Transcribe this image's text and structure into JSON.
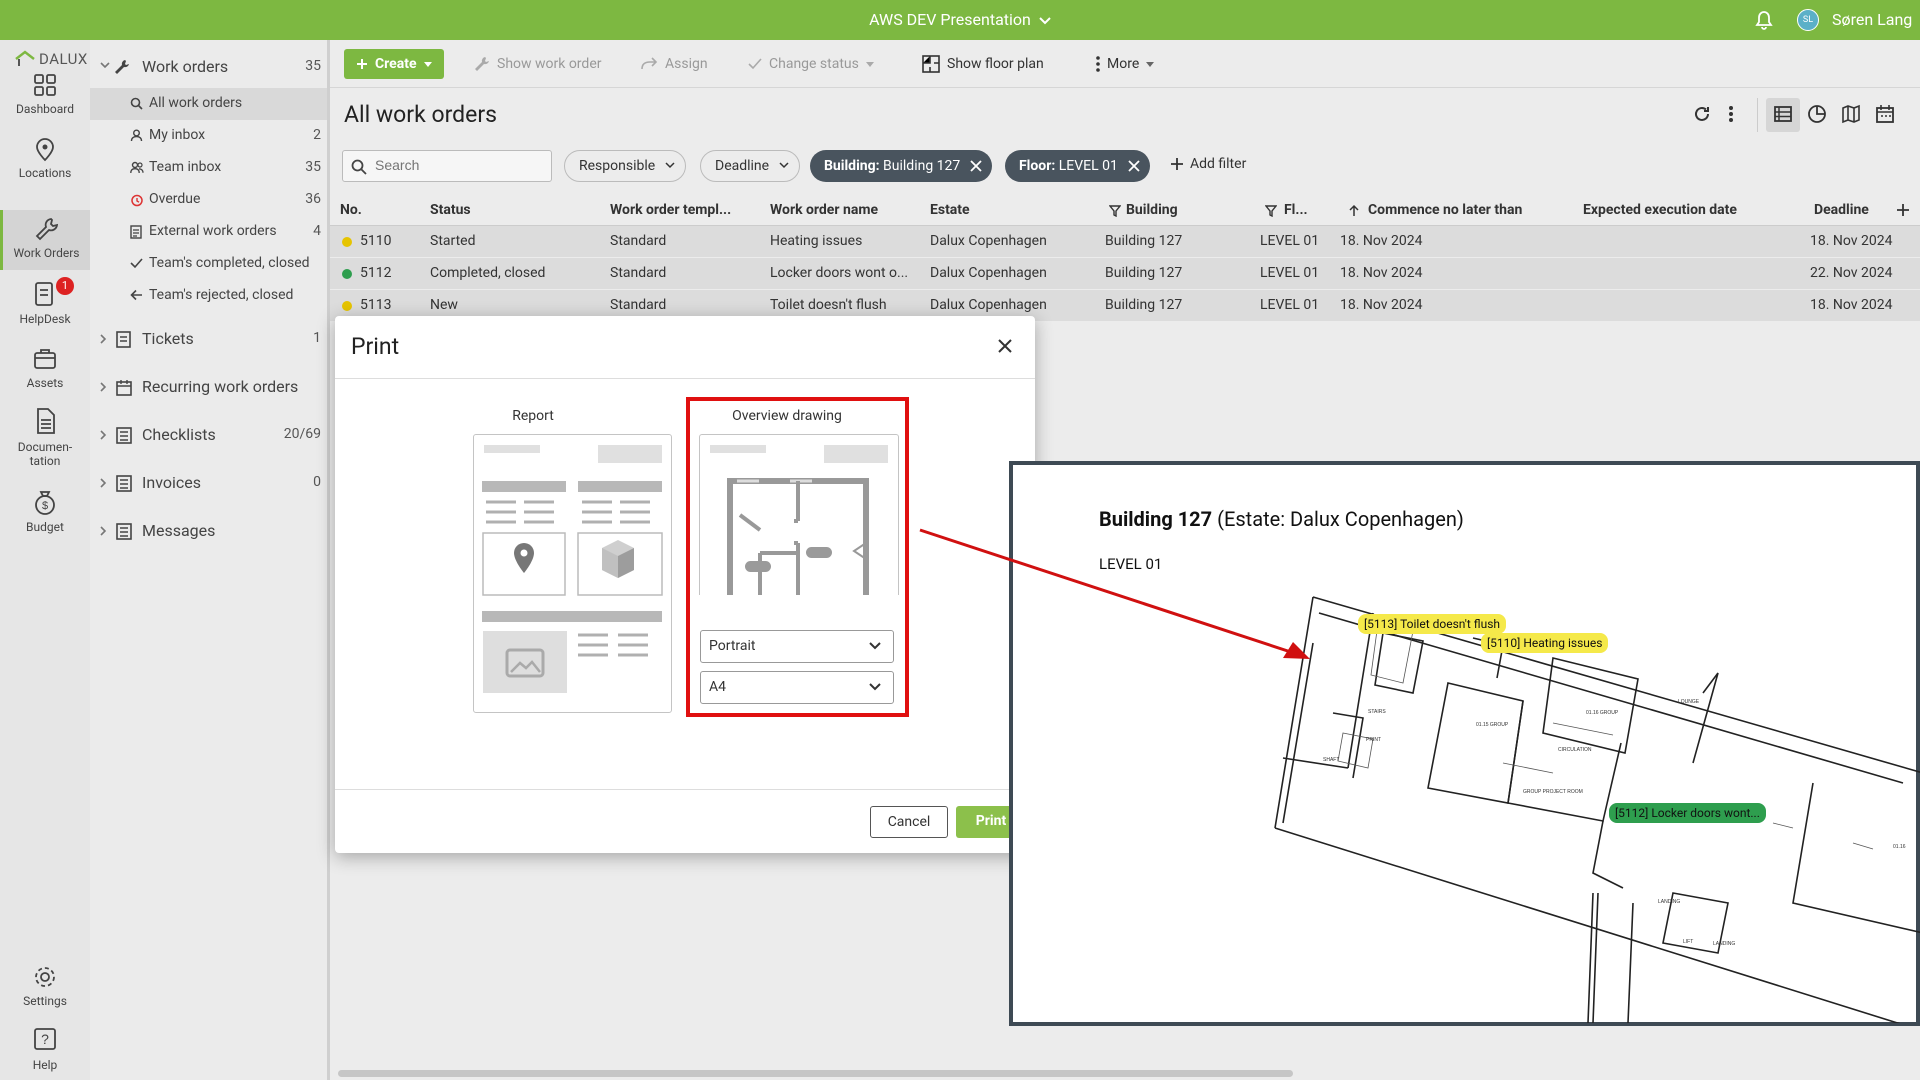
{
  "topbar": {
    "project": "AWS DEV Presentation",
    "avatar_initials": "SL",
    "user": "Søren Lang"
  },
  "brand": {
    "logo_text": "DALUX"
  },
  "rail": [
    {
      "label": "Dashboard",
      "icon": "dashboard-icon"
    },
    {
      "label": "Locations",
      "icon": "location-pin-icon"
    },
    {
      "label": "Work Orders",
      "icon": "wrench-icon",
      "active": true
    },
    {
      "label": "HelpDesk",
      "icon": "helpdesk-icon",
      "badge": "1"
    },
    {
      "label": "Assets",
      "icon": "briefcase-icon"
    },
    {
      "label": "Documen-",
      "label2": "tation",
      "icon": "document-icon"
    },
    {
      "label": "Budget",
      "icon": "money-bag-icon"
    },
    {
      "label": "Settings",
      "icon": "gear-icon"
    },
    {
      "label": "Help",
      "icon": "help-icon"
    }
  ],
  "tree": {
    "work_orders": {
      "label": "Work orders",
      "count": "35"
    },
    "items": [
      {
        "label": "All work orders",
        "count": ""
      },
      {
        "label": "My inbox",
        "count": "2"
      },
      {
        "label": "Team inbox",
        "count": "35"
      },
      {
        "label": "Overdue",
        "count": "36"
      },
      {
        "label": "External work orders",
        "count": "4"
      },
      {
        "label": "Team's completed, closed",
        "count": ""
      },
      {
        "label": "Team's rejected, closed",
        "count": ""
      }
    ],
    "sections": [
      {
        "label": "Tickets",
        "count": "1"
      },
      {
        "label": "Recurring work orders",
        "count": ""
      },
      {
        "label": "Checklists",
        "count": "20/69"
      },
      {
        "label": "Invoices",
        "count": "0"
      },
      {
        "label": "Messages",
        "count": ""
      }
    ]
  },
  "toolbar": {
    "create": "Create",
    "show_work_order": "Show work order",
    "assign": "Assign",
    "change_status": "Change status",
    "show_floor_plan": "Show floor plan",
    "more": "More"
  },
  "page": {
    "title": "All work orders"
  },
  "filters": {
    "search_placeholder": "Search",
    "responsible": "Responsible",
    "deadline": "Deadline",
    "chip1_key": "Building:",
    "chip1_val": "Building 127",
    "chip2_key": "Floor:",
    "chip2_val": "LEVEL 01",
    "add_filter": "Add filter"
  },
  "table": {
    "headers": [
      "No.",
      "Status",
      "Work order templ...",
      "Work order name",
      "Estate",
      "Building",
      "Fl...",
      "Commence no later than",
      "Expected execution date",
      "Deadline"
    ],
    "rows": [
      {
        "no": "5110",
        "status": "Started",
        "template": "Standard",
        "name": "Heating issues",
        "estate": "Dalux Copenhagen",
        "building": "Building 127",
        "floor": "LEVEL 01",
        "commence": "18. Nov 2024",
        "expected": "",
        "deadline": "18. Nov 2024",
        "status_color": "#e6c400"
      },
      {
        "no": "5112",
        "status": "Completed, closed",
        "template": "Standard",
        "name": "Locker doors wont o...",
        "estate": "Dalux Copenhagen",
        "building": "Building 127",
        "floor": "LEVEL 01",
        "commence": "18. Nov 2024",
        "expected": "",
        "deadline": "22. Nov 2024",
        "status_color": "#2e9e4e"
      },
      {
        "no": "5113",
        "status": "New",
        "template": "Standard",
        "name": "Toilet doesn't flush",
        "estate": "Dalux Copenhagen",
        "building": "Building 127",
        "floor": "LEVEL 01",
        "commence": "18. Nov 2024",
        "expected": "",
        "deadline": "18. Nov 2024",
        "status_color": "#e6c400"
      }
    ]
  },
  "dialog": {
    "title": "Print",
    "option_report": "Report",
    "option_overview": "Overview drawing",
    "orientation": "Portrait",
    "paper": "A4",
    "cancel": "Cancel",
    "print": "Print"
  },
  "preview": {
    "building": "Building 127",
    "estate_suffix": "(Estate: Dalux Copenhagen)",
    "level": "LEVEL 01",
    "tags": [
      {
        "text": "[5113] Toilet doesn't flush",
        "color": "#f5e94a"
      },
      {
        "text": "[5110] Heating issues",
        "color": "#f5e94a"
      },
      {
        "text": "[5112] Locker doors wont...",
        "color": "#2e9e4e"
      }
    ]
  },
  "colors": {
    "brand_green": "#7db841",
    "chip_dark": "#49545e",
    "highlight_red": "#e01010",
    "arrow_red": "#d01010"
  }
}
